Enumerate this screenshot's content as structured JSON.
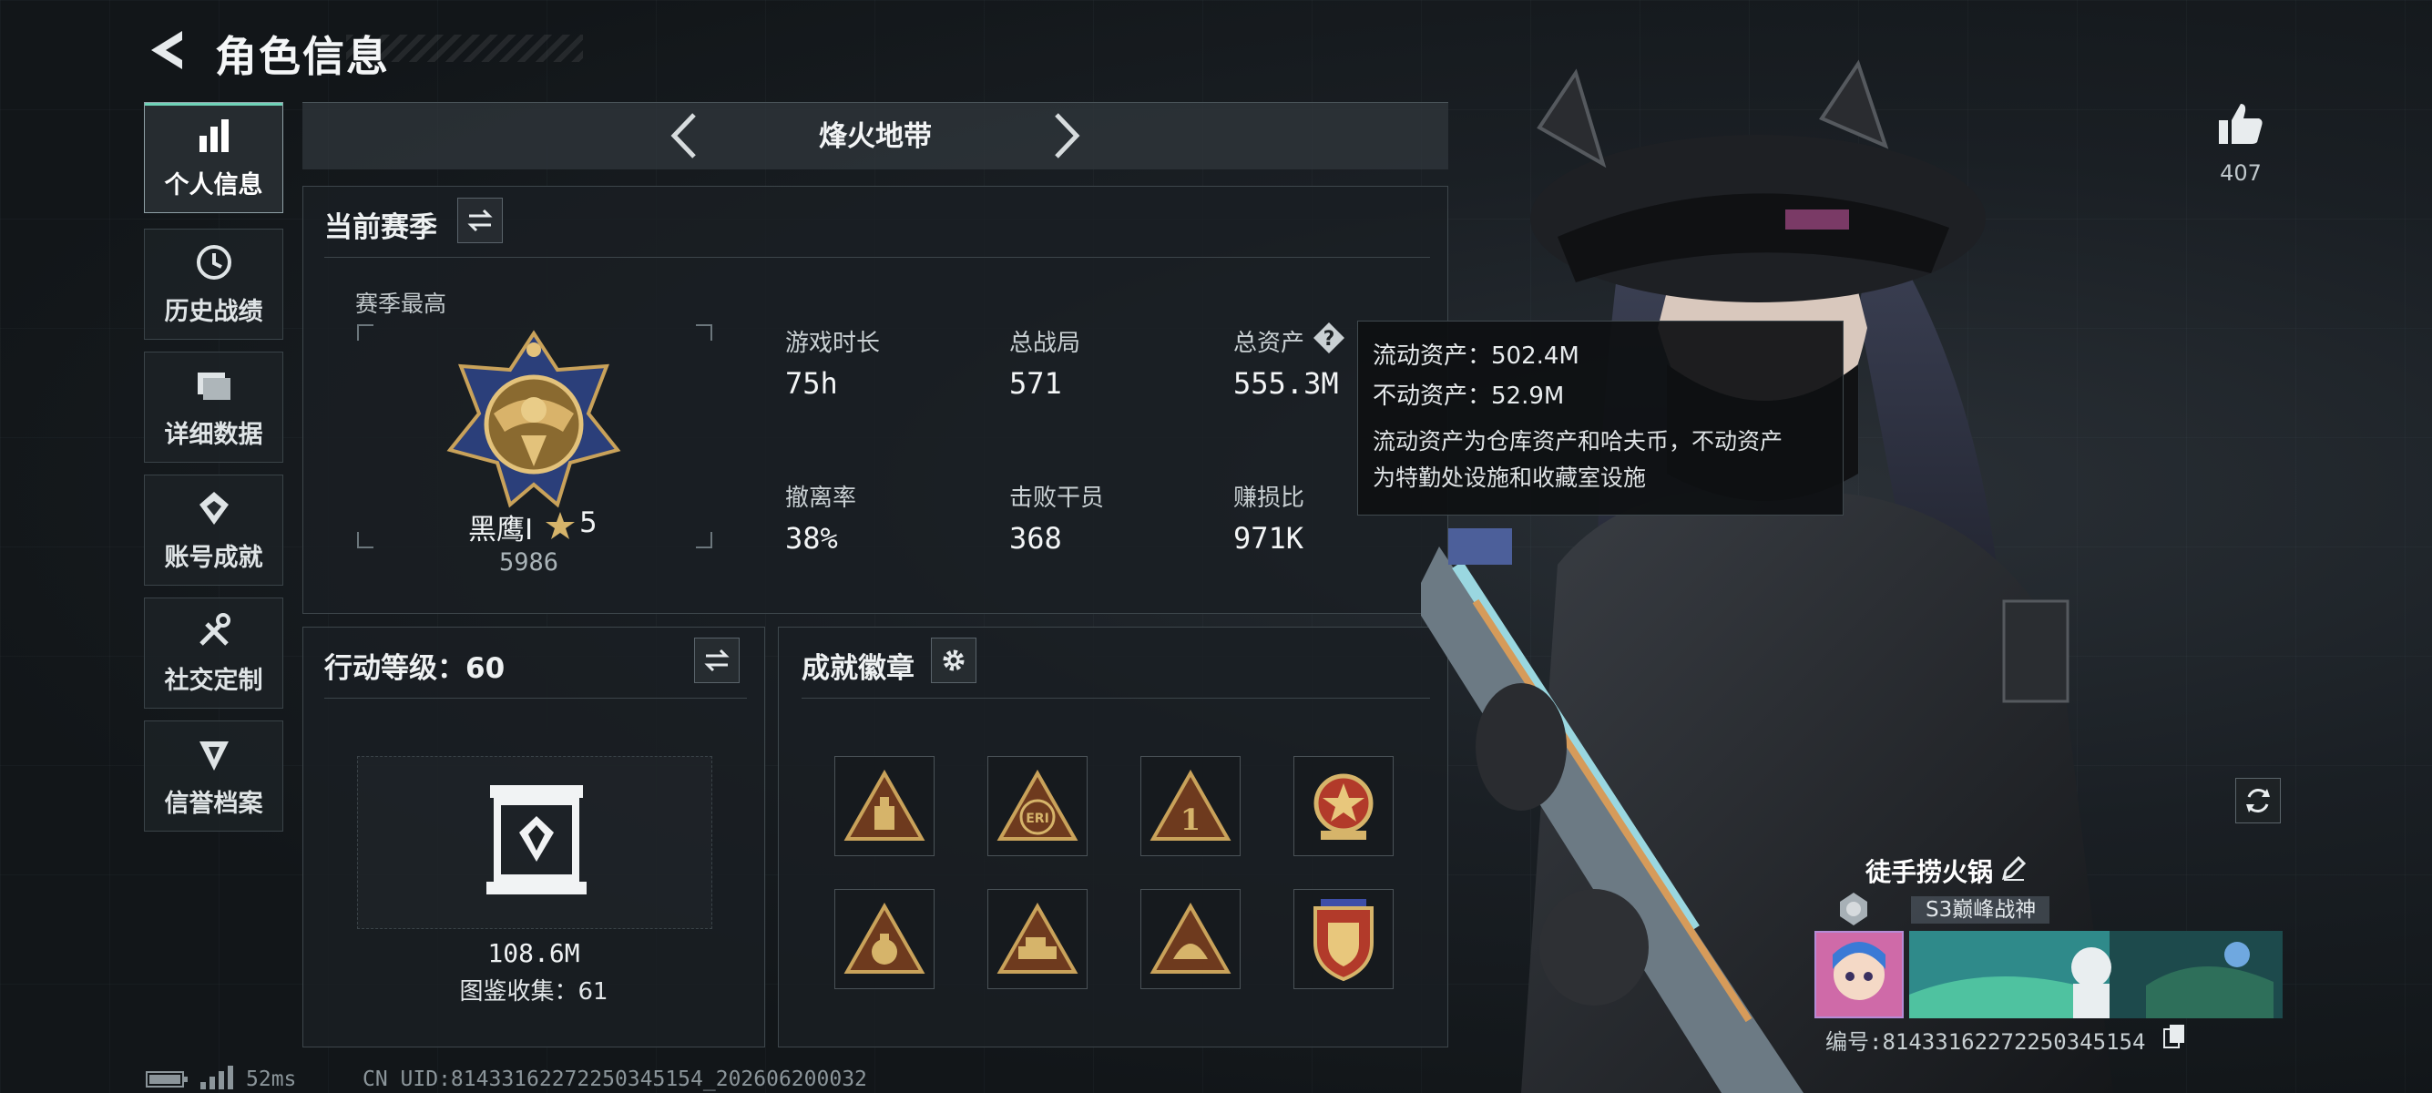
{
  "header": {
    "title": "角色信息"
  },
  "sidebar": {
    "items": [
      {
        "label": "个人信息",
        "icon": "bar-chart-icon",
        "active": true
      },
      {
        "label": "历史战绩",
        "icon": "clock-icon"
      },
      {
        "label": "详细数据",
        "icon": "folder-icon"
      },
      {
        "label": "账号成就",
        "icon": "achievement-icon"
      },
      {
        "label": "社交定制",
        "icon": "tools-icon"
      },
      {
        "label": "信誉档案",
        "icon": "shield-icon"
      }
    ]
  },
  "mode": {
    "name": "烽火地带"
  },
  "season": {
    "title": "当前赛季",
    "best_label": "赛季最高",
    "rank_name": "黑鹰I",
    "rank_stars": "5",
    "rank_score": "5986",
    "stats": [
      {
        "label": "游戏时长",
        "value": "75h"
      },
      {
        "label": "总战局",
        "value": "571"
      },
      {
        "label": "总资产",
        "value": "555.3M"
      },
      {
        "label": "撤离率",
        "value": "38%"
      },
      {
        "label": "击败干员",
        "value": "368"
      },
      {
        "label": "赚损比",
        "value": "971K"
      }
    ]
  },
  "tooltip": {
    "liquid": "流动资产：502.4M",
    "fixed": "不动资产：52.9M",
    "desc_line1": "流动资产为仓库资产和哈夫币，不动资产",
    "desc_line2": "为特勤处设施和收藏室设施"
  },
  "action_level": {
    "title": "行动等级：60",
    "collection_value": "108.6M",
    "collection_label": "图鉴收集：61"
  },
  "achievements": {
    "title": "成就徽章",
    "badges": [
      "badge-supply-icon",
      "badge-eri-icon",
      "badge-first-icon",
      "badge-star-emblem-icon",
      "badge-money-bag-icon",
      "badge-vehicle-icon",
      "badge-helmet-icon",
      "badge-shield-crest-icon"
    ]
  },
  "player": {
    "likes": "407",
    "name": "徒手捞火锅",
    "title": "S3巅峰战神",
    "id_line": "编号:8143316227225034515­4"
  },
  "footer": {
    "ping": "52ms",
    "uid": "CN UID:8143316227225034515­4_202606200032"
  },
  "colors": {
    "accent": "#6fd3b8",
    "panel": "#1a1f23",
    "gold": "#c9a25a"
  }
}
